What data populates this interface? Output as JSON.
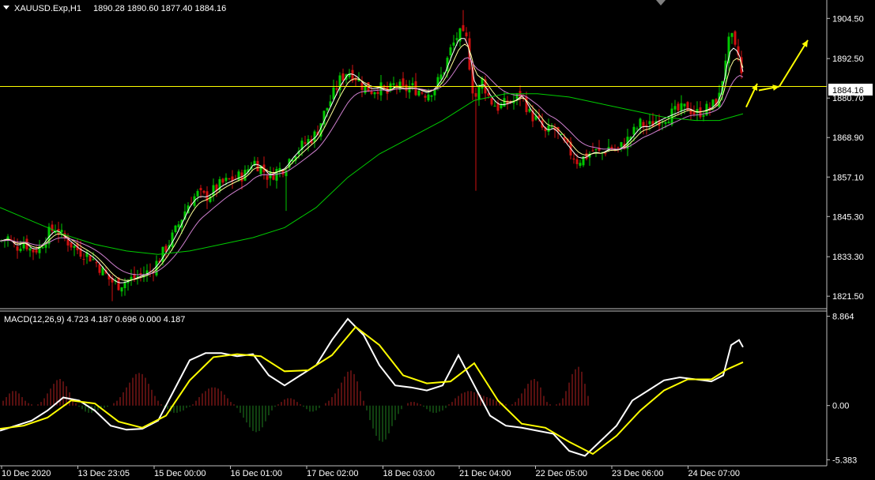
{
  "header": {
    "symbol": "XAUUSD.Exp,H1",
    "ohlc": "1890.28 1890.60 1877.40 1884.16"
  },
  "macd_header": "MACD(12,26,9) 4.723 4.187 0.696 0.000 4.187",
  "current_price_label": "1884.16",
  "colors": {
    "background": "#000000",
    "bull_candle": "#00c800",
    "bear_candle": "#d01010",
    "price_line": "#ffff00",
    "ma_fast": "#ffffff",
    "ma_mid": "#ffff99",
    "ma_slow": "#d080d0",
    "ma_long": "#00cc00",
    "macd_line": "#ffffff",
    "signal_line": "#ffff00",
    "hist_pos": "#b02020",
    "hist_neg": "#208020",
    "axis_text": "#ffffff"
  },
  "chart_data": [
    {
      "type": "candlestick",
      "title": "XAUUSD.Exp,H1",
      "y_ticks": [
        "1904.50",
        "1892.50",
        "1880.70",
        "1868.90",
        "1857.10",
        "1845.30",
        "1833.30",
        "1821.50"
      ],
      "x_ticks": [
        "10 Dec 2020",
        "13 Dec 23:05",
        "15 Dec 00:00",
        "16 Dec 01:00",
        "17 Dec 02:00",
        "18 Dec 03:00",
        "21 Dec 04:00",
        "22 Dec 05:00",
        "23 Dec 06:00",
        "24 Dec 07:00"
      ],
      "ylim": [
        1818,
        1910
      ],
      "current_price": 1884.16,
      "close_path": [
        [
          0,
          1838
        ],
        [
          10,
          1839
        ],
        [
          20,
          1836
        ],
        [
          30,
          1838
        ],
        [
          40,
          1835
        ],
        [
          50,
          1836
        ],
        [
          60,
          1840
        ],
        [
          70,
          1842
        ],
        [
          80,
          1839
        ],
        [
          90,
          1837
        ],
        [
          100,
          1835
        ],
        [
          110,
          1834
        ],
        [
          120,
          1832
        ],
        [
          130,
          1829
        ],
        [
          140,
          1826
        ],
        [
          150,
          1825
        ],
        [
          160,
          1826
        ],
        [
          170,
          1827
        ],
        [
          180,
          1828
        ],
        [
          190,
          1829
        ],
        [
          200,
          1832
        ],
        [
          210,
          1836
        ],
        [
          220,
          1840
        ],
        [
          230,
          1845
        ],
        [
          240,
          1850
        ],
        [
          250,
          1852
        ],
        [
          260,
          1851
        ],
        [
          270,
          1853
        ],
        [
          280,
          1855
        ],
        [
          290,
          1856
        ],
        [
          300,
          1857
        ],
        [
          310,
          1858
        ],
        [
          320,
          1862
        ],
        [
          330,
          1860
        ],
        [
          340,
          1857
        ],
        [
          350,
          1859
        ],
        [
          360,
          1860
        ],
        [
          370,
          1864
        ],
        [
          380,
          1866
        ],
        [
          390,
          1868
        ],
        [
          400,
          1870
        ],
        [
          410,
          1876
        ],
        [
          420,
          1881
        ],
        [
          430,
          1886
        ],
        [
          440,
          1889
        ],
        [
          450,
          1887
        ],
        [
          460,
          1884
        ],
        [
          470,
          1883
        ],
        [
          480,
          1884
        ],
        [
          490,
          1882
        ],
        [
          500,
          1885
        ],
        [
          510,
          1883
        ],
        [
          520,
          1884
        ],
        [
          530,
          1883
        ],
        [
          540,
          1882
        ],
        [
          550,
          1884
        ],
        [
          560,
          1888
        ],
        [
          570,
          1895
        ],
        [
          580,
          1900
        ],
        [
          590,
          1898
        ],
        [
          600,
          1880
        ],
        [
          610,
          1886
        ],
        [
          620,
          1880
        ],
        [
          630,
          1878
        ],
        [
          640,
          1879
        ],
        [
          650,
          1880
        ],
        [
          660,
          1882
        ],
        [
          670,
          1876
        ],
        [
          680,
          1874
        ],
        [
          690,
          1870
        ],
        [
          700,
          1872
        ],
        [
          710,
          1868
        ],
        [
          720,
          1865
        ],
        [
          730,
          1862
        ],
        [
          740,
          1863
        ],
        [
          750,
          1865
        ],
        [
          760,
          1864
        ],
        [
          770,
          1866
        ],
        [
          780,
          1865
        ],
        [
          790,
          1867
        ],
        [
          800,
          1870
        ],
        [
          810,
          1873
        ],
        [
          820,
          1872
        ],
        [
          830,
          1874
        ],
        [
          840,
          1875
        ],
        [
          850,
          1876
        ],
        [
          860,
          1877
        ],
        [
          870,
          1878
        ],
        [
          880,
          1876
        ],
        [
          890,
          1877
        ],
        [
          900,
          1878
        ],
        [
          910,
          1881
        ],
        [
          915,
          1888
        ],
        [
          920,
          1896
        ],
        [
          925,
          1899
        ],
        [
          930,
          1895
        ],
        [
          935,
          1893
        ],
        [
          940,
          1884
        ]
      ],
      "ma_long_path": [
        [
          0,
          1848
        ],
        [
          40,
          1844
        ],
        [
          80,
          1840
        ],
        [
          120,
          1837
        ],
        [
          160,
          1835
        ],
        [
          200,
          1834
        ],
        [
          240,
          1835
        ],
        [
          280,
          1837
        ],
        [
          320,
          1839
        ],
        [
          360,
          1842
        ],
        [
          400,
          1848
        ],
        [
          440,
          1857
        ],
        [
          480,
          1864
        ],
        [
          520,
          1869
        ],
        [
          560,
          1874
        ],
        [
          600,
          1880
        ],
        [
          640,
          1882
        ],
        [
          680,
          1882
        ],
        [
          720,
          1881
        ],
        [
          760,
          1879
        ],
        [
          800,
          1877
        ],
        [
          840,
          1875
        ],
        [
          880,
          1874
        ],
        [
          910,
          1874
        ],
        [
          940,
          1876
        ]
      ],
      "projection_arrows": [
        [
          [
            944,
            1878
          ],
          [
            958,
            1885
          ]
        ],
        [
          [
            960,
            1883
          ],
          [
            986,
            1884.16
          ]
        ],
        [
          [
            986,
            1884.16
          ],
          [
            1022,
            1898
          ]
        ]
      ]
    },
    {
      "type": "macd",
      "name": "MACD(12,26,9)",
      "y_ticks": [
        "8.864",
        "0.00",
        "-5.383"
      ],
      "ylim": [
        -5.9,
        9.3
      ],
      "macd_path": [
        [
          0,
          -2.5
        ],
        [
          20,
          -2.0
        ],
        [
          40,
          -1.5
        ],
        [
          60,
          -0.5
        ],
        [
          80,
          0.8
        ],
        [
          100,
          0.5
        ],
        [
          120,
          -0.5
        ],
        [
          140,
          -2.0
        ],
        [
          160,
          -2.4
        ],
        [
          180,
          -2.3
        ],
        [
          200,
          -1.5
        ],
        [
          220,
          1.5
        ],
        [
          240,
          4.5
        ],
        [
          260,
          5.2
        ],
        [
          280,
          5.2
        ],
        [
          300,
          4.9
        ],
        [
          320,
          5.1
        ],
        [
          340,
          3.0
        ],
        [
          360,
          2.0
        ],
        [
          380,
          3.0
        ],
        [
          400,
          4.0
        ],
        [
          420,
          6.5
        ],
        [
          440,
          8.6
        ],
        [
          460,
          7.0
        ],
        [
          480,
          4.0
        ],
        [
          500,
          2.0
        ],
        [
          520,
          1.8
        ],
        [
          540,
          1.5
        ],
        [
          560,
          2.0
        ],
        [
          580,
          5.0
        ],
        [
          600,
          2.0
        ],
        [
          620,
          -1.0
        ],
        [
          640,
          -2.0
        ],
        [
          660,
          -2.2
        ],
        [
          680,
          -2.5
        ],
        [
          700,
          -2.8
        ],
        [
          720,
          -4.5
        ],
        [
          740,
          -5.0
        ],
        [
          760,
          -3.5
        ],
        [
          780,
          -2.0
        ],
        [
          800,
          0.5
        ],
        [
          820,
          1.5
        ],
        [
          840,
          2.5
        ],
        [
          860,
          2.8
        ],
        [
          880,
          2.6
        ],
        [
          900,
          2.4
        ],
        [
          915,
          3.0
        ],
        [
          925,
          6.0
        ],
        [
          935,
          6.5
        ],
        [
          940,
          5.8
        ]
      ],
      "signal_path": [
        [
          0,
          -2.3
        ],
        [
          30,
          -2.0
        ],
        [
          60,
          -1.2
        ],
        [
          90,
          0.5
        ],
        [
          120,
          0.2
        ],
        [
          150,
          -1.6
        ],
        [
          180,
          -2.2
        ],
        [
          210,
          -1.0
        ],
        [
          240,
          2.5
        ],
        [
          270,
          4.8
        ],
        [
          300,
          5.1
        ],
        [
          330,
          4.9
        ],
        [
          360,
          3.4
        ],
        [
          390,
          3.5
        ],
        [
          420,
          5.0
        ],
        [
          450,
          7.8
        ],
        [
          480,
          6.0
        ],
        [
          510,
          3.0
        ],
        [
          540,
          2.2
        ],
        [
          570,
          2.4
        ],
        [
          600,
          4.2
        ],
        [
          630,
          0.5
        ],
        [
          660,
          -1.8
        ],
        [
          690,
          -2.2
        ],
        [
          720,
          -3.6
        ],
        [
          750,
          -4.8
        ],
        [
          780,
          -3.0
        ],
        [
          810,
          -0.5
        ],
        [
          840,
          1.5
        ],
        [
          870,
          2.6
        ],
        [
          900,
          2.6
        ],
        [
          920,
          3.6
        ],
        [
          940,
          4.3
        ]
      ],
      "histogram_start_x": 4,
      "histogram_step": 4,
      "histogram": [
        0.4,
        0.7,
        1.0,
        1.2,
        1.2,
        1.0,
        0.7,
        0.4,
        0.2,
        0.1,
        0.0,
        0.1,
        0.3,
        0.6,
        1.0,
        1.4,
        1.8,
        2.1,
        2.2,
        2.0,
        1.6,
        1.1,
        0.6,
        0.2,
        -0.1,
        -0.3,
        -0.5,
        -0.6,
        -0.6,
        -0.5,
        -0.4,
        -0.3,
        -0.2,
        -0.1,
        0.0,
        0.2,
        0.4,
        0.7,
        1.1,
        1.5,
        1.9,
        2.3,
        2.6,
        2.7,
        2.6,
        2.3,
        1.8,
        1.3,
        0.8,
        0.4,
        0.1,
        -0.1,
        -0.3,
        -0.5,
        -0.6,
        -0.6,
        -0.5,
        -0.4,
        -0.2,
        -0.1,
        0.1,
        0.4,
        0.7,
        1.0,
        1.2,
        1.4,
        1.5,
        1.5,
        1.4,
        1.2,
        0.9,
        0.6,
        0.3,
        0.1,
        -0.2,
        -0.6,
        -1.0,
        -1.4,
        -1.8,
        -2.1,
        -2.2,
        -2.1,
        -1.8,
        -1.3,
        -0.8,
        -0.4,
        -0.1,
        0.1,
        0.3,
        0.5,
        0.6,
        0.6,
        0.5,
        0.3,
        0.1,
        -0.1,
        -0.3,
        -0.5,
        -0.5,
        -0.4,
        -0.2,
        0.0,
        0.2,
        0.4,
        0.7,
        1.0,
        1.4,
        1.9,
        2.4,
        2.8,
        2.9,
        2.6,
        2.0,
        1.2,
        0.4,
        -0.4,
        -1.2,
        -1.9,
        -2.5,
        -2.9,
        -3.0,
        -2.8,
        -2.3,
        -1.7,
        -1.2,
        -0.7,
        -0.3,
        0.0,
        0.2,
        0.3,
        0.3,
        0.2,
        0.1,
        -0.1,
        -0.3,
        -0.5,
        -0.6,
        -0.6,
        -0.5,
        -0.4,
        -0.2,
        0.1,
        0.3,
        0.6,
        0.8,
        1.0,
        1.1,
        1.2,
        1.2,
        1.1,
        1.0,
        0.9,
        0.8,
        0.7,
        0.6,
        0.5,
        0.4,
        0.3,
        0.2,
        0.1,
        0.0,
        0.1,
        0.3,
        0.6,
        1.0,
        1.4,
        1.8,
        2.1,
        2.2,
        2.0,
        1.5,
        0.8,
        0.3,
        0.1,
        0.0,
        0.1,
        0.2,
        0.6,
        1.2,
        1.9,
        2.6,
        3.0,
        3.2,
        2.8,
        1.8,
        0.8
      ]
    }
  ]
}
